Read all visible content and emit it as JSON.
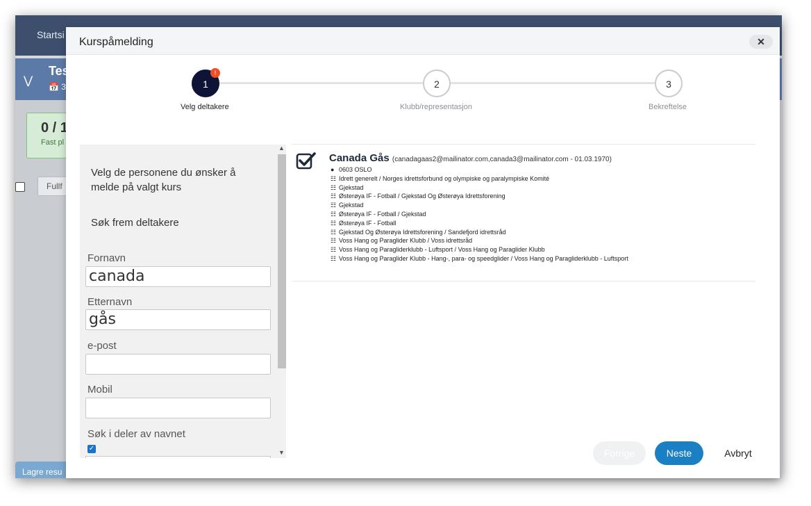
{
  "background": {
    "tab_label": "Startsi",
    "header_title": "Tes",
    "header_sub": "3",
    "card_count": "0 / 1",
    "card_label": "Fast pl",
    "fullf_label": "Fullf",
    "save_label": "Lagre resu"
  },
  "modal": {
    "title": "Kurspåmelding",
    "close": "✕"
  },
  "stepper": [
    {
      "number": "1",
      "label": "Velg deltakere",
      "badge": "!",
      "state": "active"
    },
    {
      "number": "2",
      "label": "Klubb/representasjon",
      "state": "inactive"
    },
    {
      "number": "3",
      "label": "Bekreftelse",
      "state": "inactive"
    }
  ],
  "left_panel": {
    "intro": "Velg de personene du ønsker å melde på valgt kurs",
    "search_title": "Søk frem deltakere",
    "fields": {
      "firstname_label": "Fornavn",
      "firstname_value": "canada",
      "lastname_label": "Etternavn",
      "lastname_value": "gås",
      "email_label": "e-post",
      "email_value": "",
      "mobile_label": "Mobil",
      "mobile_value": "",
      "partial_label": "Søk i deler av navnet",
      "partial_checked": true
    }
  },
  "result": {
    "name": "Canada Gås",
    "contact": "(canadagaas2@mailinator.com,canada3@mailinator.com - 01.03.1970)",
    "address": "0603 OSLO",
    "orgs": [
      "Idrett generelt / Norges idrettsforbund og olympiske og paralympiske Komité",
      "Gjekstad",
      "Østerøya IF - Fotball / Gjekstad Og Østerøya Idrettsforening",
      "Gjekstad",
      "Østerøya IF - Fotball / Gjekstad",
      "Østerøya IF - Fotball",
      "Gjekstad Og Østerøya Idrettsforening / Sandefjord idrettsråd",
      "Voss Hang og Paraglider Klubb / Voss idrettsråd",
      "Voss Hang og Paragliderklubb - Luftsport / Voss Hang og Paraglider Klubb",
      "Voss Hang og Paraglider Klubb - Hang-, para- og speedglider / Voss Hang og Paragliderklubb - Luftsport"
    ]
  },
  "footer": {
    "prev": "Forrige",
    "next": "Neste",
    "cancel": "Avbryt"
  },
  "colors": {
    "accent": "#1b7fc4",
    "step_active": "#0f1436",
    "badge": "#ef4f24"
  }
}
